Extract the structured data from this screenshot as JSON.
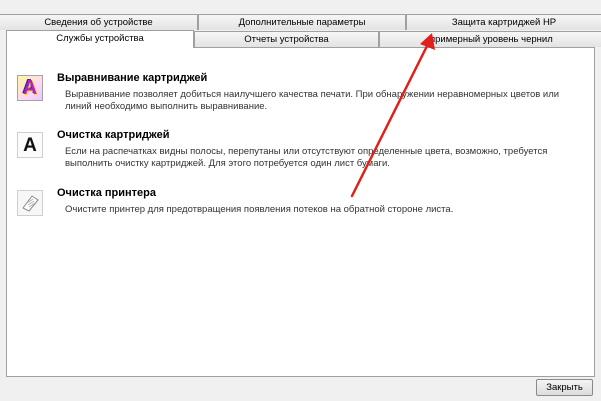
{
  "tabs": {
    "row1": [
      {
        "label": "Сведения об устройстве"
      },
      {
        "label": "Дополнительные параметры"
      },
      {
        "label": "Защита картриджей HP"
      }
    ],
    "row2": [
      {
        "label": "Службы устройства",
        "active": true
      },
      {
        "label": "Отчеты устройства"
      },
      {
        "label": "примерный уровень чернил"
      }
    ]
  },
  "services": [
    {
      "title": "Выравнивание картриджей",
      "description": "Выравнивание позволяет добиться наилучшего качества печати.  При обнаружении неравномерных цветов или линий необходимо выполнить выравнивание.",
      "icon": "cartridge-align-icon"
    },
    {
      "title": "Очистка картриджей",
      "description": "Если на распечатках видны полосы, перепутаны или отсутствуют определенные цвета, возможно, требуется выполнить очистку картриджей.  Для этого потребуется один лист бумаги.",
      "icon": "cartridge-clean-icon"
    },
    {
      "title": "Очистка принтера",
      "description": "Очистите принтер для предотвращения появления потеков на обратной стороне листа.",
      "icon": "printer-clean-icon"
    }
  ],
  "footer": {
    "close_label": "Закрыть"
  },
  "annotation": {
    "arrow_color": "#e0201b"
  }
}
